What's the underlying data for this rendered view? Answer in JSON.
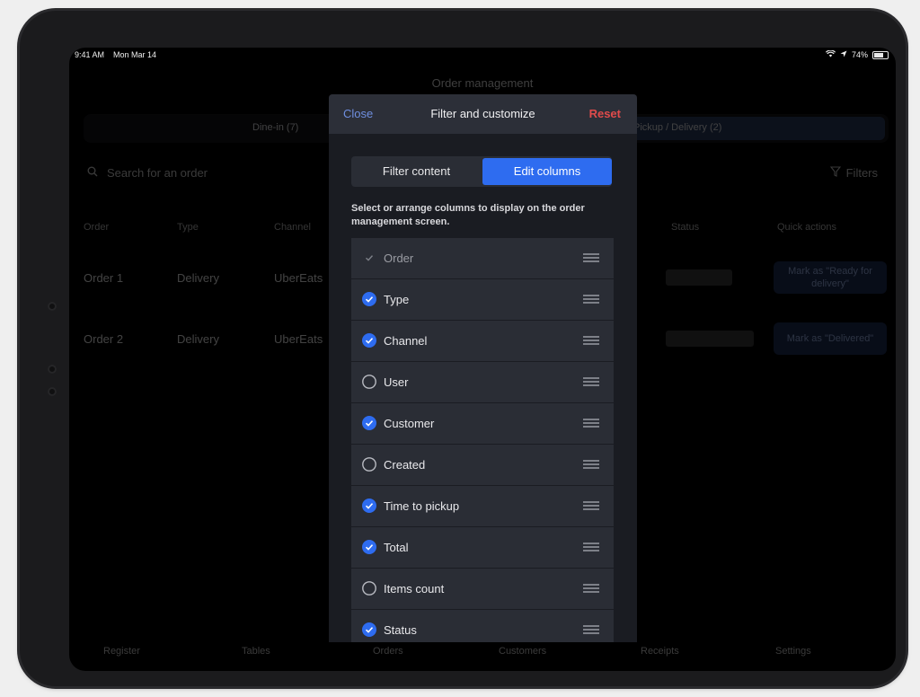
{
  "status_bar": {
    "time": "9:41 AM",
    "date": "Mon Mar 14",
    "battery": "74%"
  },
  "background": {
    "title": "Order management",
    "segment": {
      "dine_in": "Dine-in (7)",
      "pickup_delivery": "Pickup / Delivery (2)"
    },
    "search_placeholder": "Search for an order",
    "filters_label": "Filters",
    "columns": [
      "Order",
      "Type",
      "Channel",
      "Status",
      "Quick actions"
    ],
    "rows": [
      {
        "order": "Order 1",
        "type": "Delivery",
        "channel": "UberEats",
        "quick_action": "Mark as \"Ready for delivery\""
      },
      {
        "order": "Order 2",
        "type": "Delivery",
        "channel": "UberEats",
        "quick_action": "Mark as \"Delivered\""
      }
    ],
    "tabbar": [
      "Register",
      "Tables",
      "Orders",
      "Customers",
      "Receipts",
      "Settings"
    ]
  },
  "modal": {
    "close_label": "Close",
    "title": "Filter and customize",
    "reset_label": "Reset",
    "tabs": {
      "filter": "Filter content",
      "edit": "Edit columns"
    },
    "description": "Select or arrange columns to display on the order management screen.",
    "columns": [
      {
        "label": "Order",
        "state": "locked"
      },
      {
        "label": "Type",
        "state": "checked"
      },
      {
        "label": "Channel",
        "state": "checked"
      },
      {
        "label": "User",
        "state": "unchecked"
      },
      {
        "label": "Customer",
        "state": "checked"
      },
      {
        "label": "Created",
        "state": "unchecked"
      },
      {
        "label": "Time to pickup",
        "state": "checked"
      },
      {
        "label": "Total",
        "state": "checked"
      },
      {
        "label": "Items count",
        "state": "unchecked"
      },
      {
        "label": "Status",
        "state": "checked"
      }
    ]
  },
  "colors": {
    "accent": "#2e6cf0",
    "reset": "#e04b4b",
    "close": "#6f8fe0"
  }
}
